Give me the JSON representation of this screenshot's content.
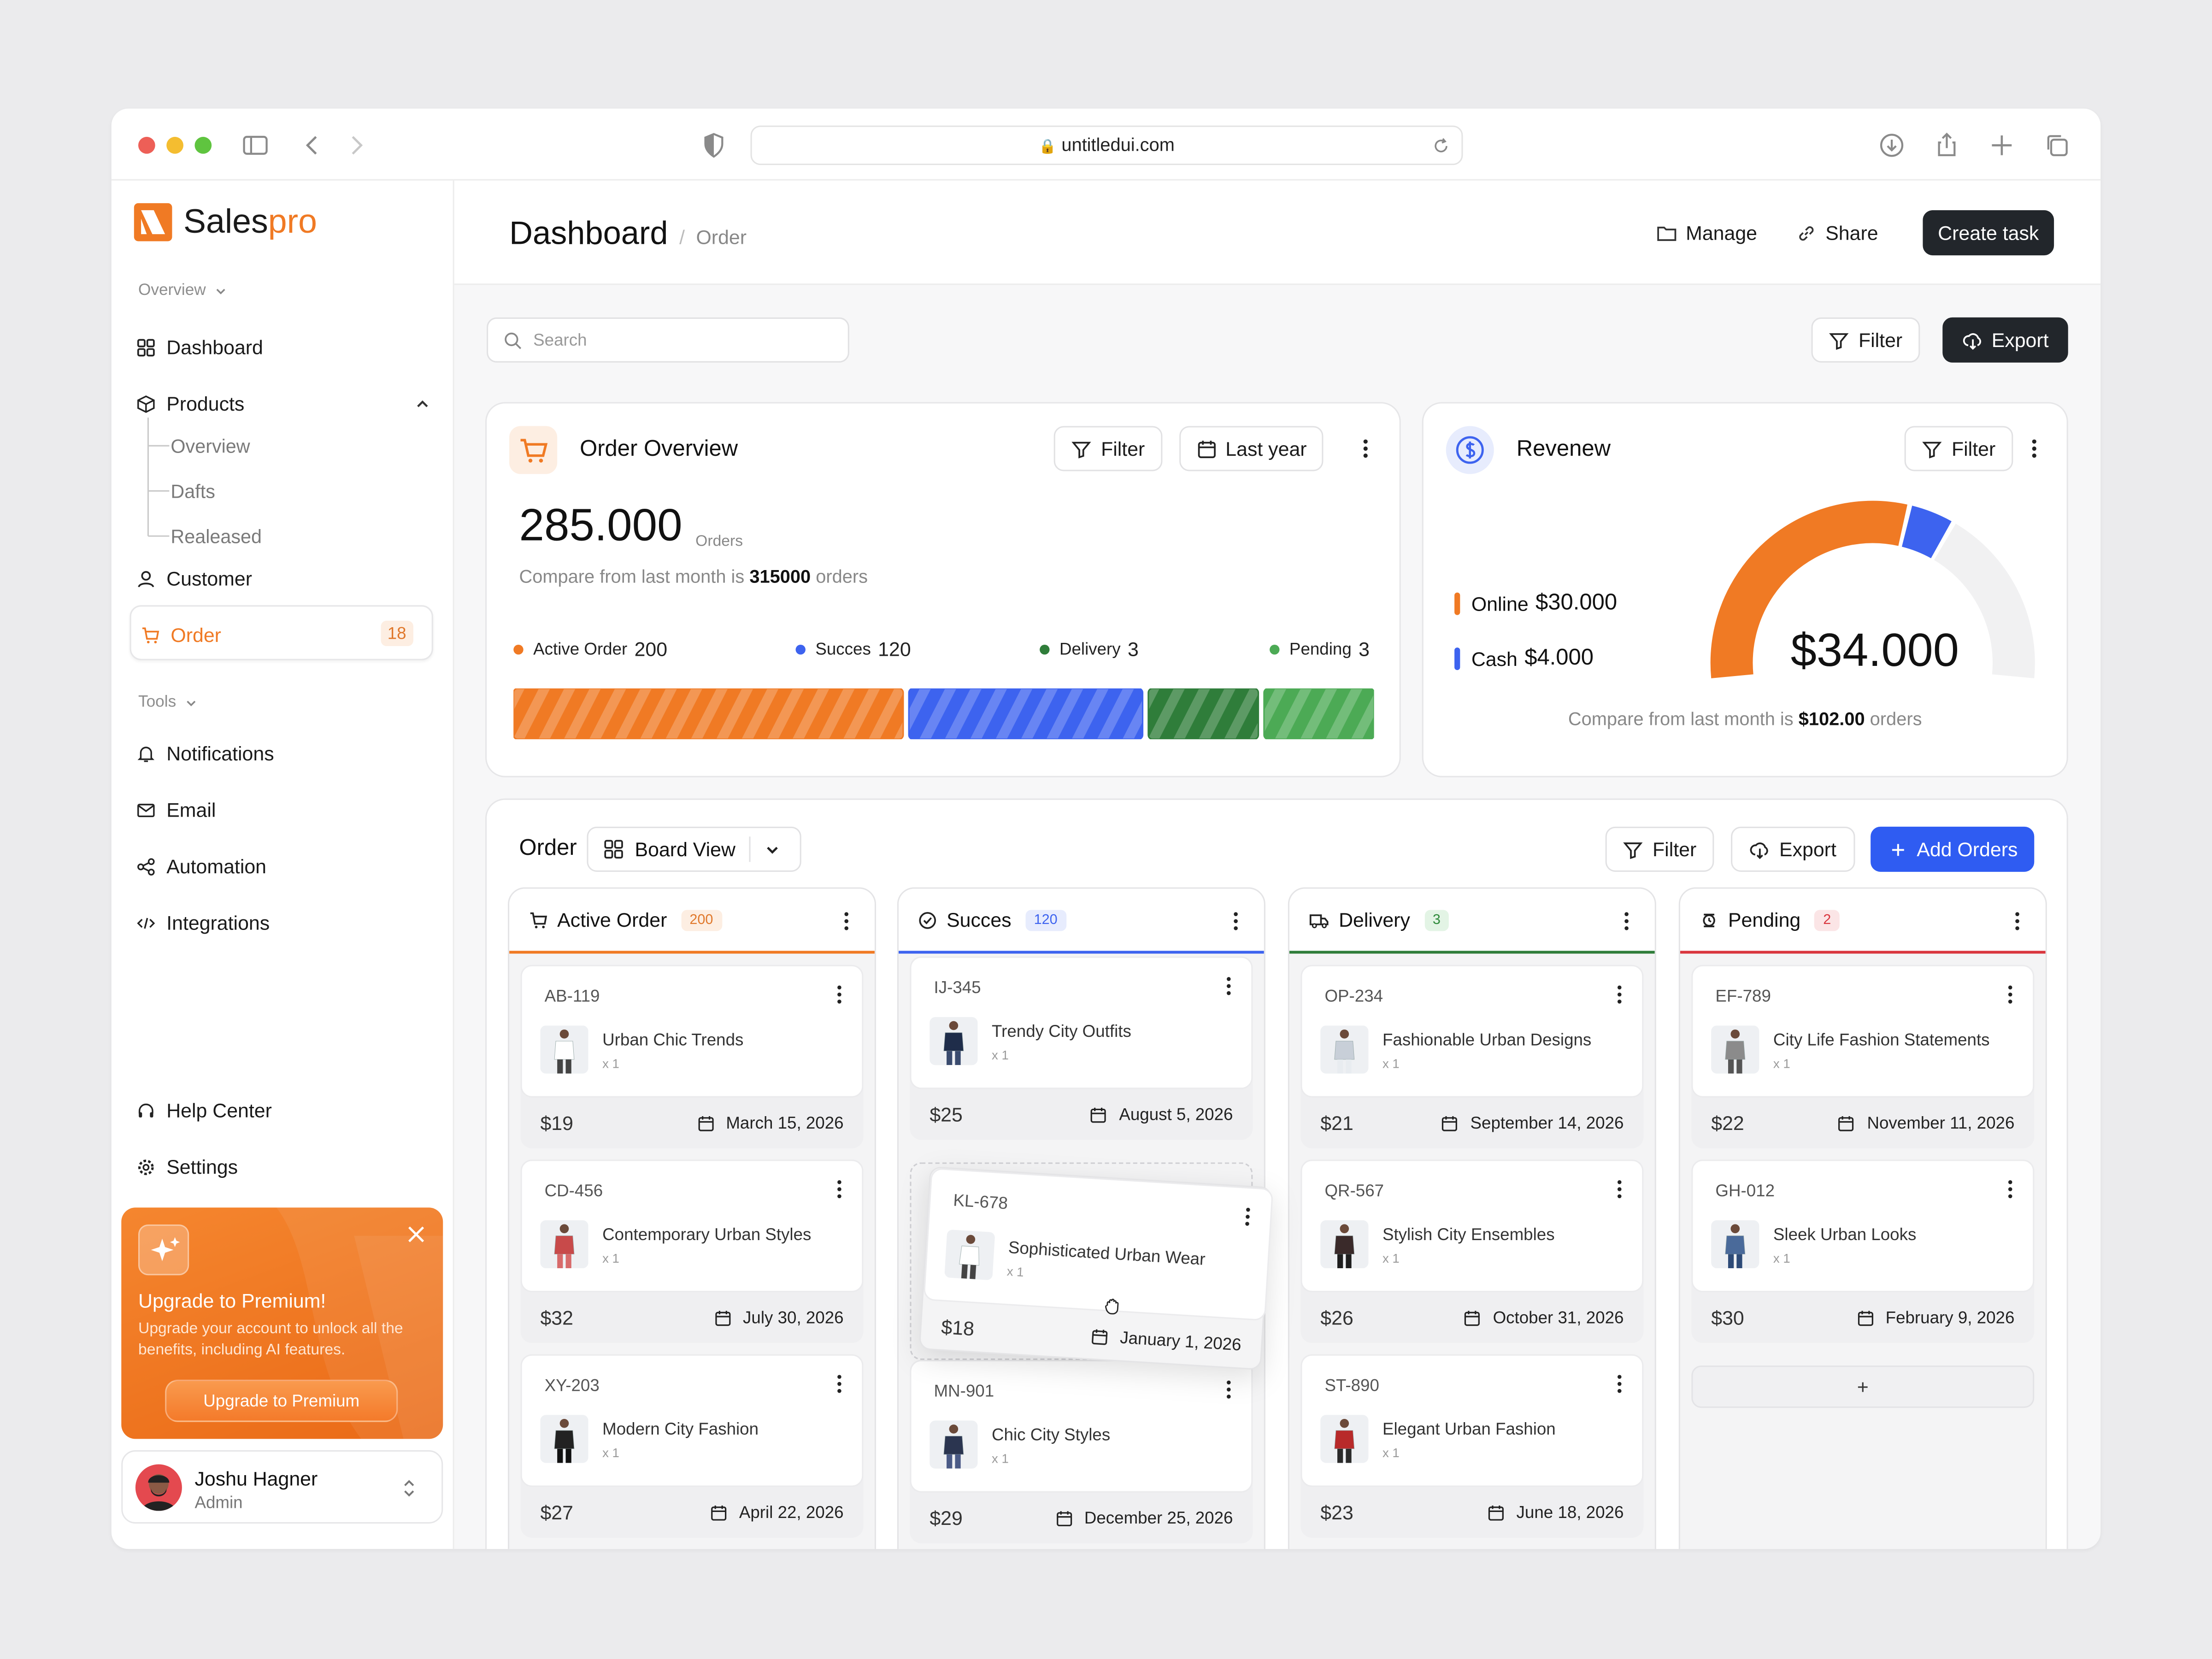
{
  "browser": {
    "url": "untitledui.com"
  },
  "brand": {
    "name_a": "Sales",
    "name_b": "pro",
    "accent": "#f07a24"
  },
  "sidebar": {
    "overview_label": "Overview",
    "items": [
      {
        "label": "Dashboard"
      },
      {
        "label": "Products"
      },
      {
        "label": "Customer"
      },
      {
        "label": "Order",
        "badge": "18"
      }
    ],
    "products_sub": [
      "Overview",
      "Dafts",
      "Realeased"
    ],
    "tools_label": "Tools",
    "tools": [
      {
        "label": "Notifications"
      },
      {
        "label": "Email"
      },
      {
        "label": "Automation"
      },
      {
        "label": "Integrations"
      }
    ],
    "bottom": [
      {
        "label": "Help Center"
      },
      {
        "label": "Settings"
      }
    ],
    "promo": {
      "title": "Upgrade to Premium!",
      "text": "Upgrade your account to unlock all the benefits, including AI features.",
      "button": "Upgrade to Premium"
    },
    "user": {
      "name": "Joshu Hagner",
      "role": "Admin"
    }
  },
  "header": {
    "title": "Dashboard",
    "crumb": "Order",
    "manage": "Manage",
    "share": "Share",
    "create": "Create task"
  },
  "toolbar": {
    "search_placeholder": "Search",
    "filter": "Filter",
    "export": "Export"
  },
  "order_overview": {
    "title": "Order Overview",
    "filter": "Filter",
    "period": "Last year",
    "total": "285.000",
    "unit": "Orders",
    "compare_pre": "Compare from last month is ",
    "compare_val": "315000",
    "compare_post": " orders",
    "legend": [
      {
        "label": "Active Order",
        "value": "200",
        "color": "#f07a24"
      },
      {
        "label": "Succes",
        "value": "120",
        "color": "#3d63ef"
      },
      {
        "label": "Delivery",
        "value": "3",
        "color": "#2f7d3a"
      },
      {
        "label": "Pending",
        "value": "3",
        "color": "#4caa55"
      }
    ]
  },
  "revenue": {
    "title": "Revenew",
    "filter": "Filter",
    "total": "$34.000",
    "online_label": "Online",
    "online_value": "$30.000",
    "cash_label": "Cash",
    "cash_value": "$4.000",
    "compare_pre": "Compare from last month is ",
    "compare_val": "$102.00",
    "compare_post": " orders",
    "colors": {
      "online": "#f07a24",
      "cash": "#3d63ef",
      "rest": "#f1f1f2"
    }
  },
  "board": {
    "title": "Order",
    "view": "Board View",
    "filter": "Filter",
    "export": "Export",
    "add": "Add Orders",
    "columns": [
      {
        "title": "Active Order",
        "count": "200",
        "color": "#f07a24",
        "badge_bg": "#fdeee2",
        "badge_fg": "#e0782b",
        "cards": [
          {
            "id": "AB-119",
            "name": "Urban Chic Trends",
            "qty": "x 1",
            "price": "$19",
            "date": "March 15, 2026"
          },
          {
            "id": "CD-456",
            "name": "Contemporary Urban Styles",
            "qty": "x 1",
            "price": "$32",
            "date": "July 30, 2026"
          },
          {
            "id": "XY-203",
            "name": "Modern City Fashion",
            "qty": "x 1",
            "price": "$27",
            "date": "April 22, 2026"
          }
        ]
      },
      {
        "title": "Succes",
        "count": "120",
        "color": "#3d63ef",
        "badge_bg": "#e7ecfd",
        "badge_fg": "#3d63ef",
        "cards": [
          {
            "id": "IJ-345",
            "name": "Trendy City Outfits",
            "qty": "x 1",
            "price": "$25",
            "date": "August 5, 2026"
          },
          {
            "id": "MN-901",
            "name": "Chic City Styles",
            "qty": "x 1",
            "price": "$29",
            "date": "December 25, 2026"
          }
        ]
      },
      {
        "title": "Delivery",
        "count": "3",
        "color": "#2f7d3a",
        "badge_bg": "#e3f4e5",
        "badge_fg": "#2f8a3b",
        "cards": [
          {
            "id": "OP-234",
            "name": "Fashionable Urban Designs",
            "qty": "x 1",
            "price": "$21",
            "date": "September 14, 2026"
          },
          {
            "id": "QR-567",
            "name": "Stylish City Ensembles",
            "qty": "x 1",
            "price": "$26",
            "date": "October 31, 2026"
          },
          {
            "id": "ST-890",
            "name": "Elegant Urban Fashion",
            "qty": "x 1",
            "price": "$23",
            "date": "June 18, 2026"
          }
        ]
      },
      {
        "title": "Pending",
        "count": "2",
        "color": "#d9363e",
        "badge_bg": "#fbe5e6",
        "badge_fg": "#d9363e",
        "cards": [
          {
            "id": "EF-789",
            "name": "City Life Fashion Statements",
            "qty": "x 1",
            "price": "$22",
            "date": "November 11, 2026"
          },
          {
            "id": "GH-012",
            "name": "Sleek Urban Looks",
            "qty": "x 1",
            "price": "$30",
            "date": "February 9, 2026"
          }
        ]
      }
    ],
    "dragging": {
      "id": "KL-678",
      "name": "Sophisticated Urban Wear",
      "qty": "x 1",
      "price": "$18",
      "date": "January 1, 2026"
    },
    "add_card": "+"
  }
}
